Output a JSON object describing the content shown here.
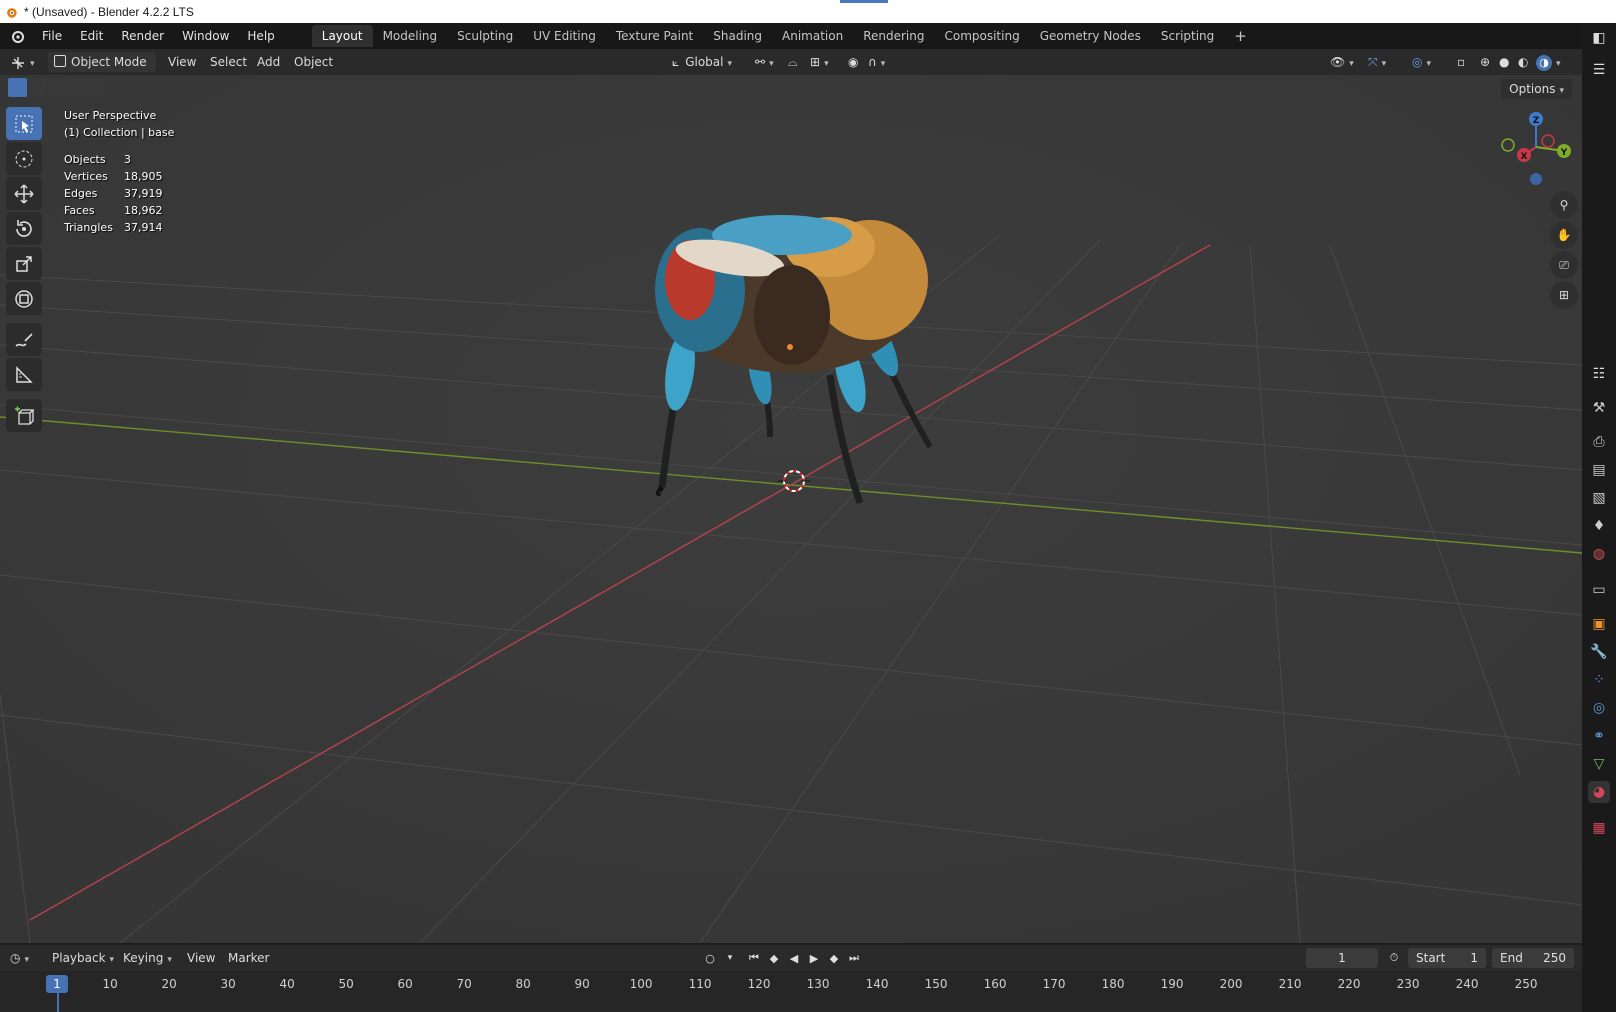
{
  "window": {
    "title": "* (Unsaved) - Blender 4.2.2 LTS"
  },
  "menubar": {
    "items": [
      "File",
      "Edit",
      "Render",
      "Window",
      "Help"
    ],
    "workspaces": [
      "Layout",
      "Modeling",
      "Sculpting",
      "UV Editing",
      "Texture Paint",
      "Shading",
      "Animation",
      "Rendering",
      "Compositing",
      "Geometry Nodes",
      "Scripting"
    ],
    "active_workspace": "Layout",
    "add_workspace": "+"
  },
  "header3d": {
    "mode": "Object Mode",
    "menus": [
      "View",
      "Select",
      "Add",
      "Object"
    ],
    "orientation": "Global",
    "options": "Options"
  },
  "viewport": {
    "perspective": "User Perspective",
    "collection": "(1) Collection | base",
    "stats": [
      {
        "label": "Objects",
        "value": "3"
      },
      {
        "label": "Vertices",
        "value": "18,905"
      },
      {
        "label": "Edges",
        "value": "37,919"
      },
      {
        "label": "Faces",
        "value": "18,962"
      },
      {
        "label": "Triangles",
        "value": "37,914"
      }
    ],
    "gizmo": {
      "x": "X",
      "y": "Y",
      "z": "Z"
    }
  },
  "timeline": {
    "menus": [
      "Playback",
      "Keying",
      "View",
      "Marker"
    ],
    "current_frame": "1",
    "start_label": "Start",
    "start_value": "1",
    "end_label": "End",
    "end_value": "250",
    "ticks": [
      "1",
      "10",
      "20",
      "30",
      "40",
      "50",
      "60",
      "70",
      "80",
      "90",
      "100",
      "110",
      "120",
      "130",
      "140",
      "150",
      "160",
      "170",
      "180",
      "190",
      "200",
      "210",
      "220",
      "230",
      "240",
      "250"
    ]
  },
  "colors": {
    "accent": "#4772b3",
    "x_axis": "#c8374a",
    "y_axis": "#7fab2b",
    "z_axis": "#3d7bd1"
  }
}
